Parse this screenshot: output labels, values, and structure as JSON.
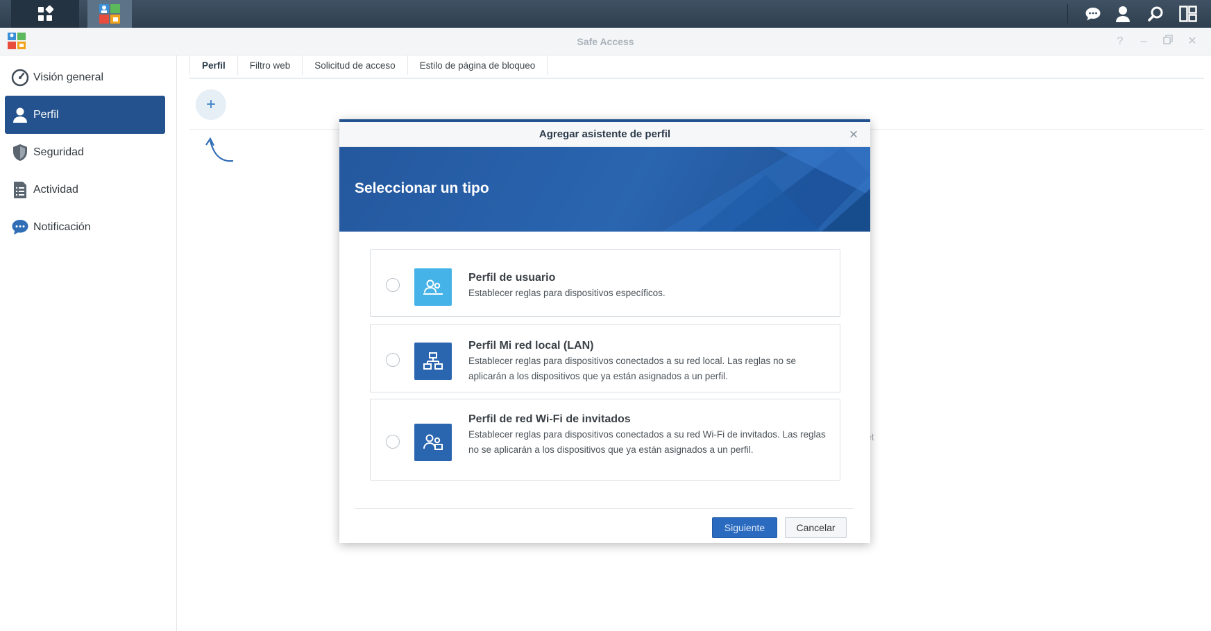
{
  "window": {
    "title": "Safe Access"
  },
  "sidebar": {
    "items": [
      {
        "label": "Visión general",
        "icon": "gauge-icon"
      },
      {
        "label": "Perfil",
        "icon": "user-icon",
        "active": true
      },
      {
        "label": "Seguridad",
        "icon": "shield-icon"
      },
      {
        "label": "Actividad",
        "icon": "document-list-icon"
      },
      {
        "label": "Notificación",
        "icon": "chat-bubble-icon"
      }
    ]
  },
  "tabs": [
    {
      "label": "Perfil",
      "active": true
    },
    {
      "label": "Filtro web"
    },
    {
      "label": "Solicitud de acceso"
    },
    {
      "label": "Estilo de página de bloqueo"
    }
  ],
  "toolbar": {
    "add_symbol": "+"
  },
  "background": {
    "partial_text": "et"
  },
  "modal": {
    "title": "Agregar asistente de perfil",
    "banner_title": "Seleccionar un tipo",
    "options": [
      {
        "title": "Perfil de usuario",
        "description": "Establecer reglas para dispositivos específicos.",
        "icon": "user-profile-icon",
        "icon_color": "#45b3e8"
      },
      {
        "title": "Perfil Mi red local (LAN)",
        "description": "Establecer reglas para dispositivos conectados a su red local. Las reglas no se aplicarán a los dispositivos que ya están asignados a un perfil.",
        "icon": "network-icon",
        "icon_color": "#2a65b0"
      },
      {
        "title": "Perfil de red Wi-Fi de invitados",
        "description": "Establecer reglas para dispositivos conectados a su red Wi-Fi de invitados. Las reglas no se aplicarán a los dispositivos que ya están asignados a un perfil.",
        "icon": "guest-network-icon",
        "icon_color": "#2a65b0"
      }
    ],
    "next_label": "Siguiente",
    "cancel_label": "Cancelar"
  },
  "colors": {
    "accent": "#24528e",
    "taskbar": "#34495c"
  }
}
